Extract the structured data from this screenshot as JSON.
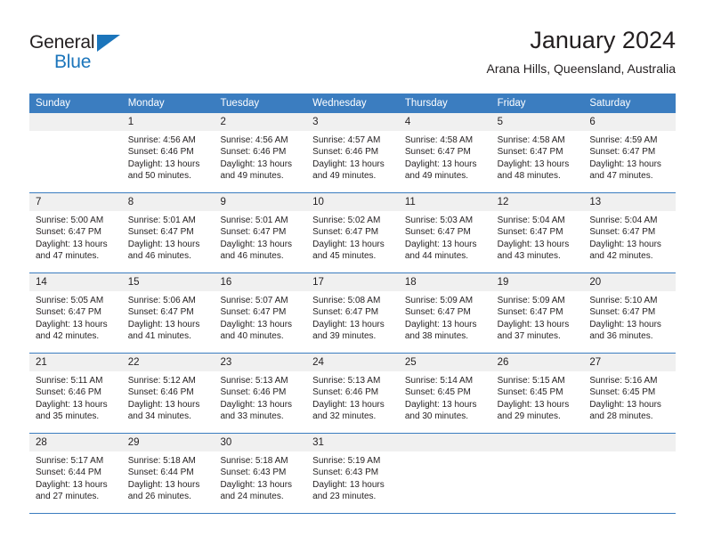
{
  "brand": {
    "name_part1": "General",
    "name_part2": "Blue",
    "triangle_color": "#1b75bb"
  },
  "header": {
    "month_title": "January 2024",
    "location": "Arana Hills, Queensland, Australia"
  },
  "theme": {
    "header_blue": "#3b7dc0",
    "daynum_band": "#f0f0f0",
    "text": "#231f20"
  },
  "calendar": {
    "weekday_headers": [
      "Sunday",
      "Monday",
      "Tuesday",
      "Wednesday",
      "Thursday",
      "Friday",
      "Saturday"
    ],
    "weeks": [
      [
        {
          "day": "",
          "lines": []
        },
        {
          "day": "1",
          "lines": [
            "Sunrise: 4:56 AM",
            "Sunset: 6:46 PM",
            "Daylight: 13 hours",
            "and 50 minutes."
          ]
        },
        {
          "day": "2",
          "lines": [
            "Sunrise: 4:56 AM",
            "Sunset: 6:46 PM",
            "Daylight: 13 hours",
            "and 49 minutes."
          ]
        },
        {
          "day": "3",
          "lines": [
            "Sunrise: 4:57 AM",
            "Sunset: 6:46 PM",
            "Daylight: 13 hours",
            "and 49 minutes."
          ]
        },
        {
          "day": "4",
          "lines": [
            "Sunrise: 4:58 AM",
            "Sunset: 6:47 PM",
            "Daylight: 13 hours",
            "and 49 minutes."
          ]
        },
        {
          "day": "5",
          "lines": [
            "Sunrise: 4:58 AM",
            "Sunset: 6:47 PM",
            "Daylight: 13 hours",
            "and 48 minutes."
          ]
        },
        {
          "day": "6",
          "lines": [
            "Sunrise: 4:59 AM",
            "Sunset: 6:47 PM",
            "Daylight: 13 hours",
            "and 47 minutes."
          ]
        }
      ],
      [
        {
          "day": "7",
          "lines": [
            "Sunrise: 5:00 AM",
            "Sunset: 6:47 PM",
            "Daylight: 13 hours",
            "and 47 minutes."
          ]
        },
        {
          "day": "8",
          "lines": [
            "Sunrise: 5:01 AM",
            "Sunset: 6:47 PM",
            "Daylight: 13 hours",
            "and 46 minutes."
          ]
        },
        {
          "day": "9",
          "lines": [
            "Sunrise: 5:01 AM",
            "Sunset: 6:47 PM",
            "Daylight: 13 hours",
            "and 46 minutes."
          ]
        },
        {
          "day": "10",
          "lines": [
            "Sunrise: 5:02 AM",
            "Sunset: 6:47 PM",
            "Daylight: 13 hours",
            "and 45 minutes."
          ]
        },
        {
          "day": "11",
          "lines": [
            "Sunrise: 5:03 AM",
            "Sunset: 6:47 PM",
            "Daylight: 13 hours",
            "and 44 minutes."
          ]
        },
        {
          "day": "12",
          "lines": [
            "Sunrise: 5:04 AM",
            "Sunset: 6:47 PM",
            "Daylight: 13 hours",
            "and 43 minutes."
          ]
        },
        {
          "day": "13",
          "lines": [
            "Sunrise: 5:04 AM",
            "Sunset: 6:47 PM",
            "Daylight: 13 hours",
            "and 42 minutes."
          ]
        }
      ],
      [
        {
          "day": "14",
          "lines": [
            "Sunrise: 5:05 AM",
            "Sunset: 6:47 PM",
            "Daylight: 13 hours",
            "and 42 minutes."
          ]
        },
        {
          "day": "15",
          "lines": [
            "Sunrise: 5:06 AM",
            "Sunset: 6:47 PM",
            "Daylight: 13 hours",
            "and 41 minutes."
          ]
        },
        {
          "day": "16",
          "lines": [
            "Sunrise: 5:07 AM",
            "Sunset: 6:47 PM",
            "Daylight: 13 hours",
            "and 40 minutes."
          ]
        },
        {
          "day": "17",
          "lines": [
            "Sunrise: 5:08 AM",
            "Sunset: 6:47 PM",
            "Daylight: 13 hours",
            "and 39 minutes."
          ]
        },
        {
          "day": "18",
          "lines": [
            "Sunrise: 5:09 AM",
            "Sunset: 6:47 PM",
            "Daylight: 13 hours",
            "and 38 minutes."
          ]
        },
        {
          "day": "19",
          "lines": [
            "Sunrise: 5:09 AM",
            "Sunset: 6:47 PM",
            "Daylight: 13 hours",
            "and 37 minutes."
          ]
        },
        {
          "day": "20",
          "lines": [
            "Sunrise: 5:10 AM",
            "Sunset: 6:47 PM",
            "Daylight: 13 hours",
            "and 36 minutes."
          ]
        }
      ],
      [
        {
          "day": "21",
          "lines": [
            "Sunrise: 5:11 AM",
            "Sunset: 6:46 PM",
            "Daylight: 13 hours",
            "and 35 minutes."
          ]
        },
        {
          "day": "22",
          "lines": [
            "Sunrise: 5:12 AM",
            "Sunset: 6:46 PM",
            "Daylight: 13 hours",
            "and 34 minutes."
          ]
        },
        {
          "day": "23",
          "lines": [
            "Sunrise: 5:13 AM",
            "Sunset: 6:46 PM",
            "Daylight: 13 hours",
            "and 33 minutes."
          ]
        },
        {
          "day": "24",
          "lines": [
            "Sunrise: 5:13 AM",
            "Sunset: 6:46 PM",
            "Daylight: 13 hours",
            "and 32 minutes."
          ]
        },
        {
          "day": "25",
          "lines": [
            "Sunrise: 5:14 AM",
            "Sunset: 6:45 PM",
            "Daylight: 13 hours",
            "and 30 minutes."
          ]
        },
        {
          "day": "26",
          "lines": [
            "Sunrise: 5:15 AM",
            "Sunset: 6:45 PM",
            "Daylight: 13 hours",
            "and 29 minutes."
          ]
        },
        {
          "day": "27",
          "lines": [
            "Sunrise: 5:16 AM",
            "Sunset: 6:45 PM",
            "Daylight: 13 hours",
            "and 28 minutes."
          ]
        }
      ],
      [
        {
          "day": "28",
          "lines": [
            "Sunrise: 5:17 AM",
            "Sunset: 6:44 PM",
            "Daylight: 13 hours",
            "and 27 minutes."
          ]
        },
        {
          "day": "29",
          "lines": [
            "Sunrise: 5:18 AM",
            "Sunset: 6:44 PM",
            "Daylight: 13 hours",
            "and 26 minutes."
          ]
        },
        {
          "day": "30",
          "lines": [
            "Sunrise: 5:18 AM",
            "Sunset: 6:43 PM",
            "Daylight: 13 hours",
            "and 24 minutes."
          ]
        },
        {
          "day": "31",
          "lines": [
            "Sunrise: 5:19 AM",
            "Sunset: 6:43 PM",
            "Daylight: 13 hours",
            "and 23 minutes."
          ]
        },
        {
          "day": "",
          "lines": []
        },
        {
          "day": "",
          "lines": []
        },
        {
          "day": "",
          "lines": []
        }
      ]
    ]
  }
}
